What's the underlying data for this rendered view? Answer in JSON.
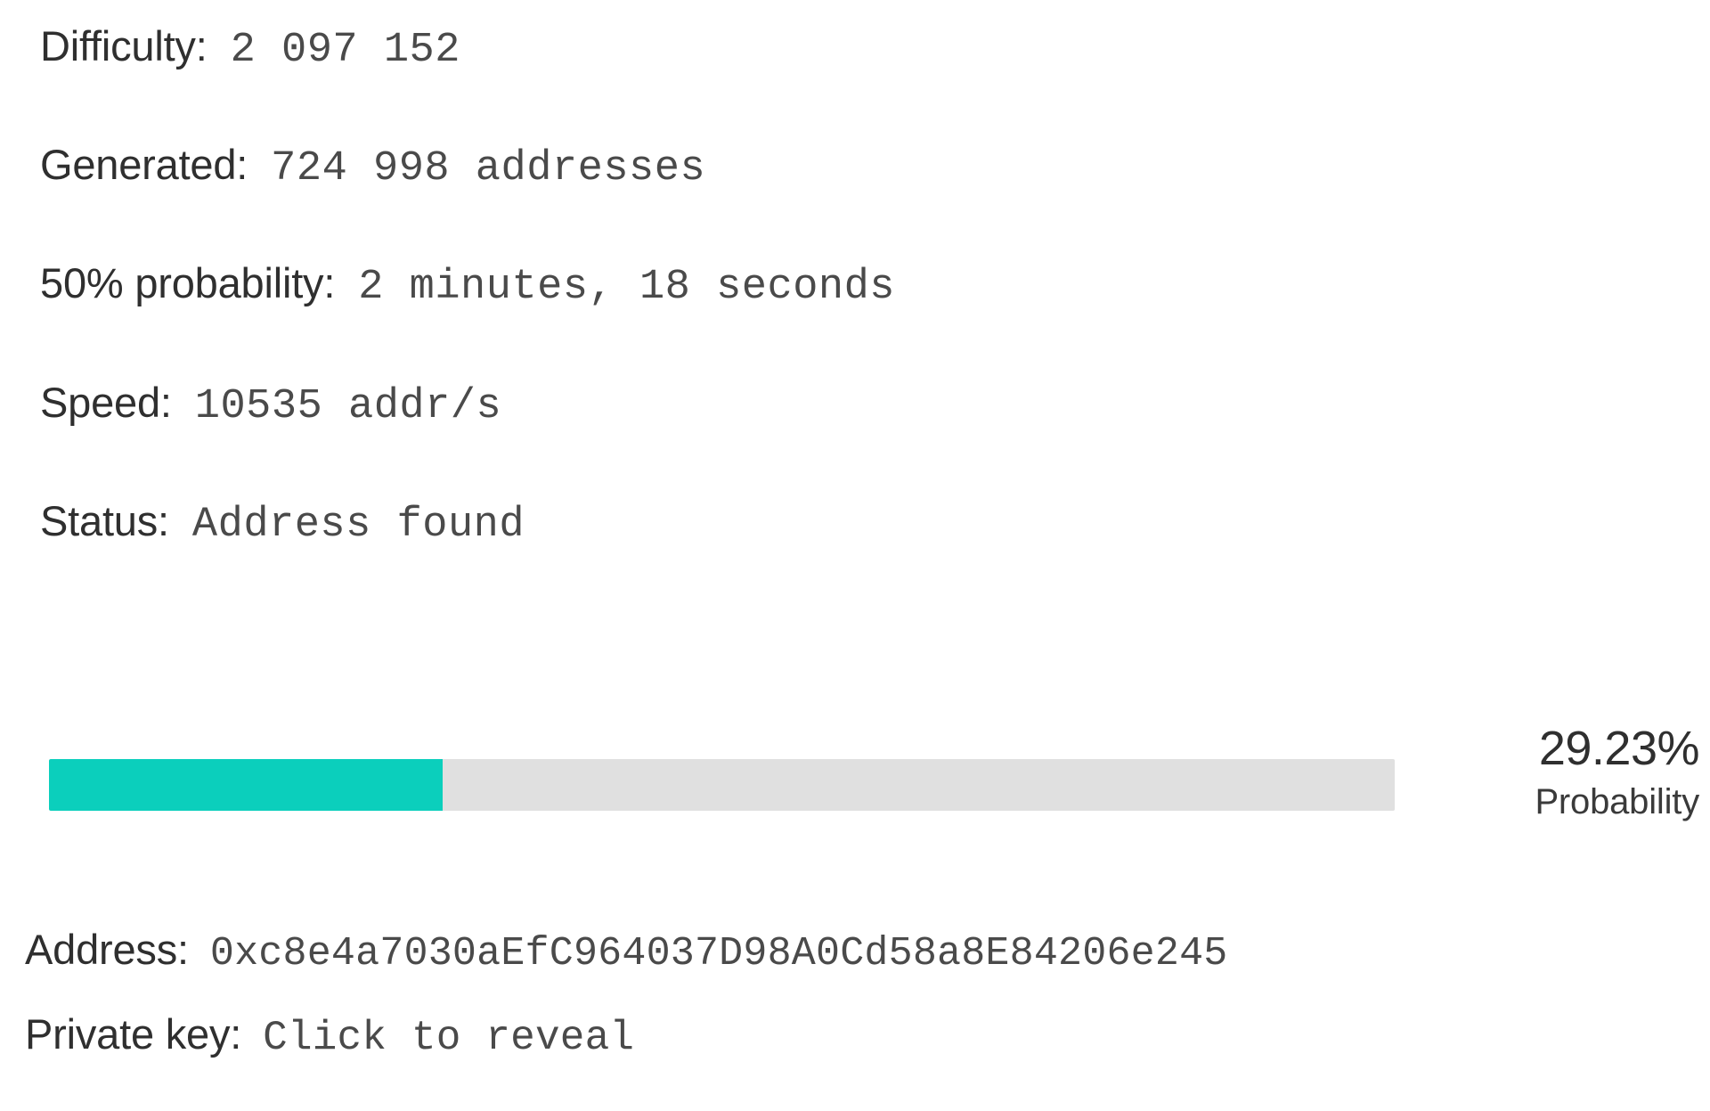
{
  "stats": {
    "rows": [
      {
        "label": "Difficulty:",
        "value": "2 097 152"
      },
      {
        "label": "Generated:",
        "value": "724 998 addresses"
      },
      {
        "label": "50% probability:",
        "value": "2 minutes, 18 seconds"
      },
      {
        "label": "Speed:",
        "value": "10535 addr/s"
      },
      {
        "label": "Status:",
        "value": "Address found"
      }
    ]
  },
  "progress": {
    "percent_label": "29.23%",
    "caption": "Probability",
    "percent_value": 29.23,
    "fill_color": "#0bcfbc",
    "track_color": "#e0e0e0"
  },
  "result": {
    "address_label": "Address:",
    "address_value": "0xc8e4a7030aEfC964037D98A0Cd58a8E84206e245",
    "private_key_label": "Private key:",
    "private_key_value": "Click to reveal"
  }
}
